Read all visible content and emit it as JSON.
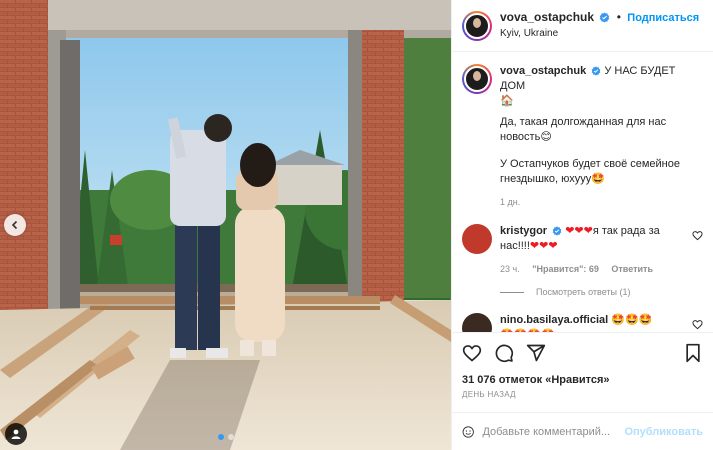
{
  "post": {
    "author": {
      "username": "vova_ostapchuk",
      "verified": true,
      "follow_label": "Подписаться",
      "separator": "•",
      "location": "Kyiv, Ukraine"
    },
    "caption": {
      "username": "vova_ostapchuk",
      "title": "У НАС БУДЕТ ДОМ",
      "title_emoji": "🏠",
      "paragraph1": "Да, такая долгожданная для нас новость",
      "paragraph1_emoji": "😊",
      "paragraph2": "У Остапчуков будет своё семейное гнездышко, юхууу",
      "paragraph2_emoji": "🤩",
      "time": "1 дн."
    },
    "comments": [
      {
        "username": "kristygor",
        "verified": true,
        "text_hearts_before": "❤❤❤",
        "text": "я так рада за нас!!!!",
        "text_hearts_after": "❤❤❤",
        "time": "23 ч.",
        "likes": "\"Нравится\": 69",
        "reply_label": "Ответить",
        "view_replies": "Посмотреть ответы (1)"
      },
      {
        "username": "nino.basilaya.official",
        "verified": false,
        "text": "🤩🤩🤩",
        "text_line2": "🤩🤩🤩🤩"
      }
    ],
    "likes_count": "31 076",
    "likes_word": "отметок",
    "likes_link": "«Нравится»",
    "date": "ДЕНЬ НАЗАД",
    "add_comment_placeholder": "Добавьте комментарий...",
    "publish_label": "Опубликовать",
    "carousel": {
      "slides": 2,
      "active": 1
    },
    "icons": {
      "like": "heart-icon",
      "comment": "comment-icon",
      "share": "share-icon",
      "save": "bookmark-icon",
      "emoji": "smiley-icon",
      "tags": "person-tag-icon",
      "prev": "chevron-left-icon",
      "verified": "verified-badge-icon"
    },
    "colors": {
      "accent": "#0095f6",
      "verified": "#3897f0",
      "publish_disabled": "#b2dffc",
      "heart": "#ed1c24",
      "muted": "#8e8e8e"
    }
  }
}
